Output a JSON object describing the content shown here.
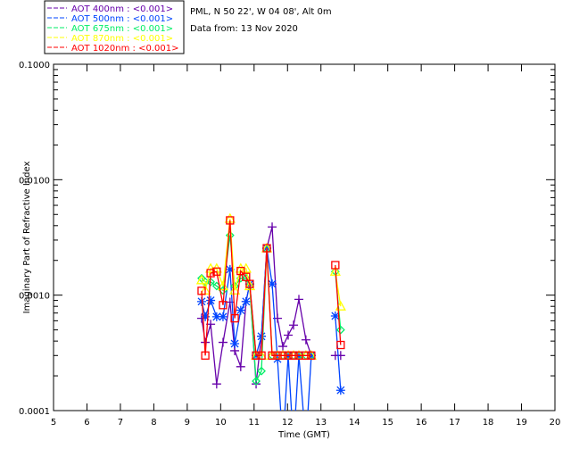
{
  "header": {
    "site_line": "PML, N 50 22', W 04 08', Alt 0m",
    "date_line": "Data from: 13 Nov 2020"
  },
  "chart_data": {
    "type": "line",
    "xlabel": "Time (GMT)",
    "ylabel": "Imaginary Part of Refractive Index",
    "xlim": [
      5,
      20
    ],
    "ylim": [
      0.0001,
      0.1
    ],
    "yscale": "log",
    "grid": false,
    "legend_placement": "top-left",
    "x_ticks": [
      "5",
      "6",
      "7",
      "8",
      "9",
      "10",
      "11",
      "12",
      "13",
      "14",
      "15",
      "16",
      "17",
      "18",
      "19",
      "20"
    ],
    "y_ticks": [
      "0.0001",
      "0.0010",
      "0.0100",
      "0.1000"
    ],
    "x": [
      9.43,
      9.54,
      9.7,
      9.88,
      10.07,
      10.28,
      10.42,
      10.6,
      10.76,
      10.87,
      11.06,
      11.22,
      11.38,
      11.54,
      11.7,
      11.86,
      12.02,
      12.18,
      12.34,
      12.55,
      12.71,
      13.43,
      13.59
    ],
    "series": [
      {
        "name": "AOT  400nm : <0.001>",
        "color": "#6600aa",
        "marker": "plus",
        "values": [
          0.00063,
          0.00039,
          0.00056,
          0.00017,
          0.00039,
          0.00087,
          0.00033,
          0.00024,
          0.00088,
          0.00125,
          0.00017,
          0.00044,
          0.00255,
          0.0039,
          0.00063,
          0.00036,
          0.00045,
          0.00055,
          0.00092,
          0.00041,
          0.0003,
          0.0003,
          0.0003
        ]
      },
      {
        "name": "AOT  500nm : <0.001>",
        "color": "#0044ff",
        "marker": "asterisk",
        "values": [
          0.00088,
          0.00065,
          0.0009,
          0.00065,
          0.00065,
          0.00167,
          0.00038,
          0.00074,
          0.00088,
          0.00125,
          0.0003,
          0.00044,
          0.00255,
          0.00125,
          0.00028,
          5e-05,
          0.0003,
          5e-05,
          0.0003,
          5e-05,
          0.0003,
          0.00066,
          0.00015
        ]
      },
      {
        "name": "AOT  675nm : <0.001>",
        "color": "#00ee66",
        "marker": "diamond",
        "values": [
          0.0014,
          0.0013,
          0.0013,
          0.0012,
          0.0011,
          0.0033,
          0.0012,
          0.0014,
          0.0014,
          0.0012,
          0.00018,
          0.00022,
          0.0025,
          0.0003,
          0.0003,
          0.0003,
          0.0003,
          0.0003,
          0.0003,
          0.0003,
          0.0003,
          0.0016,
          0.0005
        ]
      },
      {
        "name": "AOT  870nm : <0.001>",
        "color": "#ffff00",
        "marker": "triangle",
        "values": [
          0.00135,
          0.0011,
          0.0017,
          0.0017,
          0.0012,
          0.0046,
          0.0011,
          0.0017,
          0.0017,
          0.0012,
          0.0003,
          0.0003,
          0.00255,
          0.0003,
          0.0003,
          0.0003,
          0.0003,
          0.0003,
          0.0003,
          0.0003,
          0.0003,
          0.0016,
          0.0008
        ]
      },
      {
        "name": "AOT 1020nm : <0.001>",
        "color": "#ff0000",
        "marker": "square",
        "values": [
          0.00109,
          0.0003,
          0.00155,
          0.0016,
          0.00082,
          0.00444,
          0.00063,
          0.00162,
          0.00144,
          0.00125,
          0.0003,
          0.0003,
          0.00255,
          0.0003,
          0.0003,
          0.0003,
          0.0003,
          0.0003,
          0.0003,
          0.0003,
          0.0003,
          0.00182,
          0.00037
        ]
      }
    ]
  }
}
